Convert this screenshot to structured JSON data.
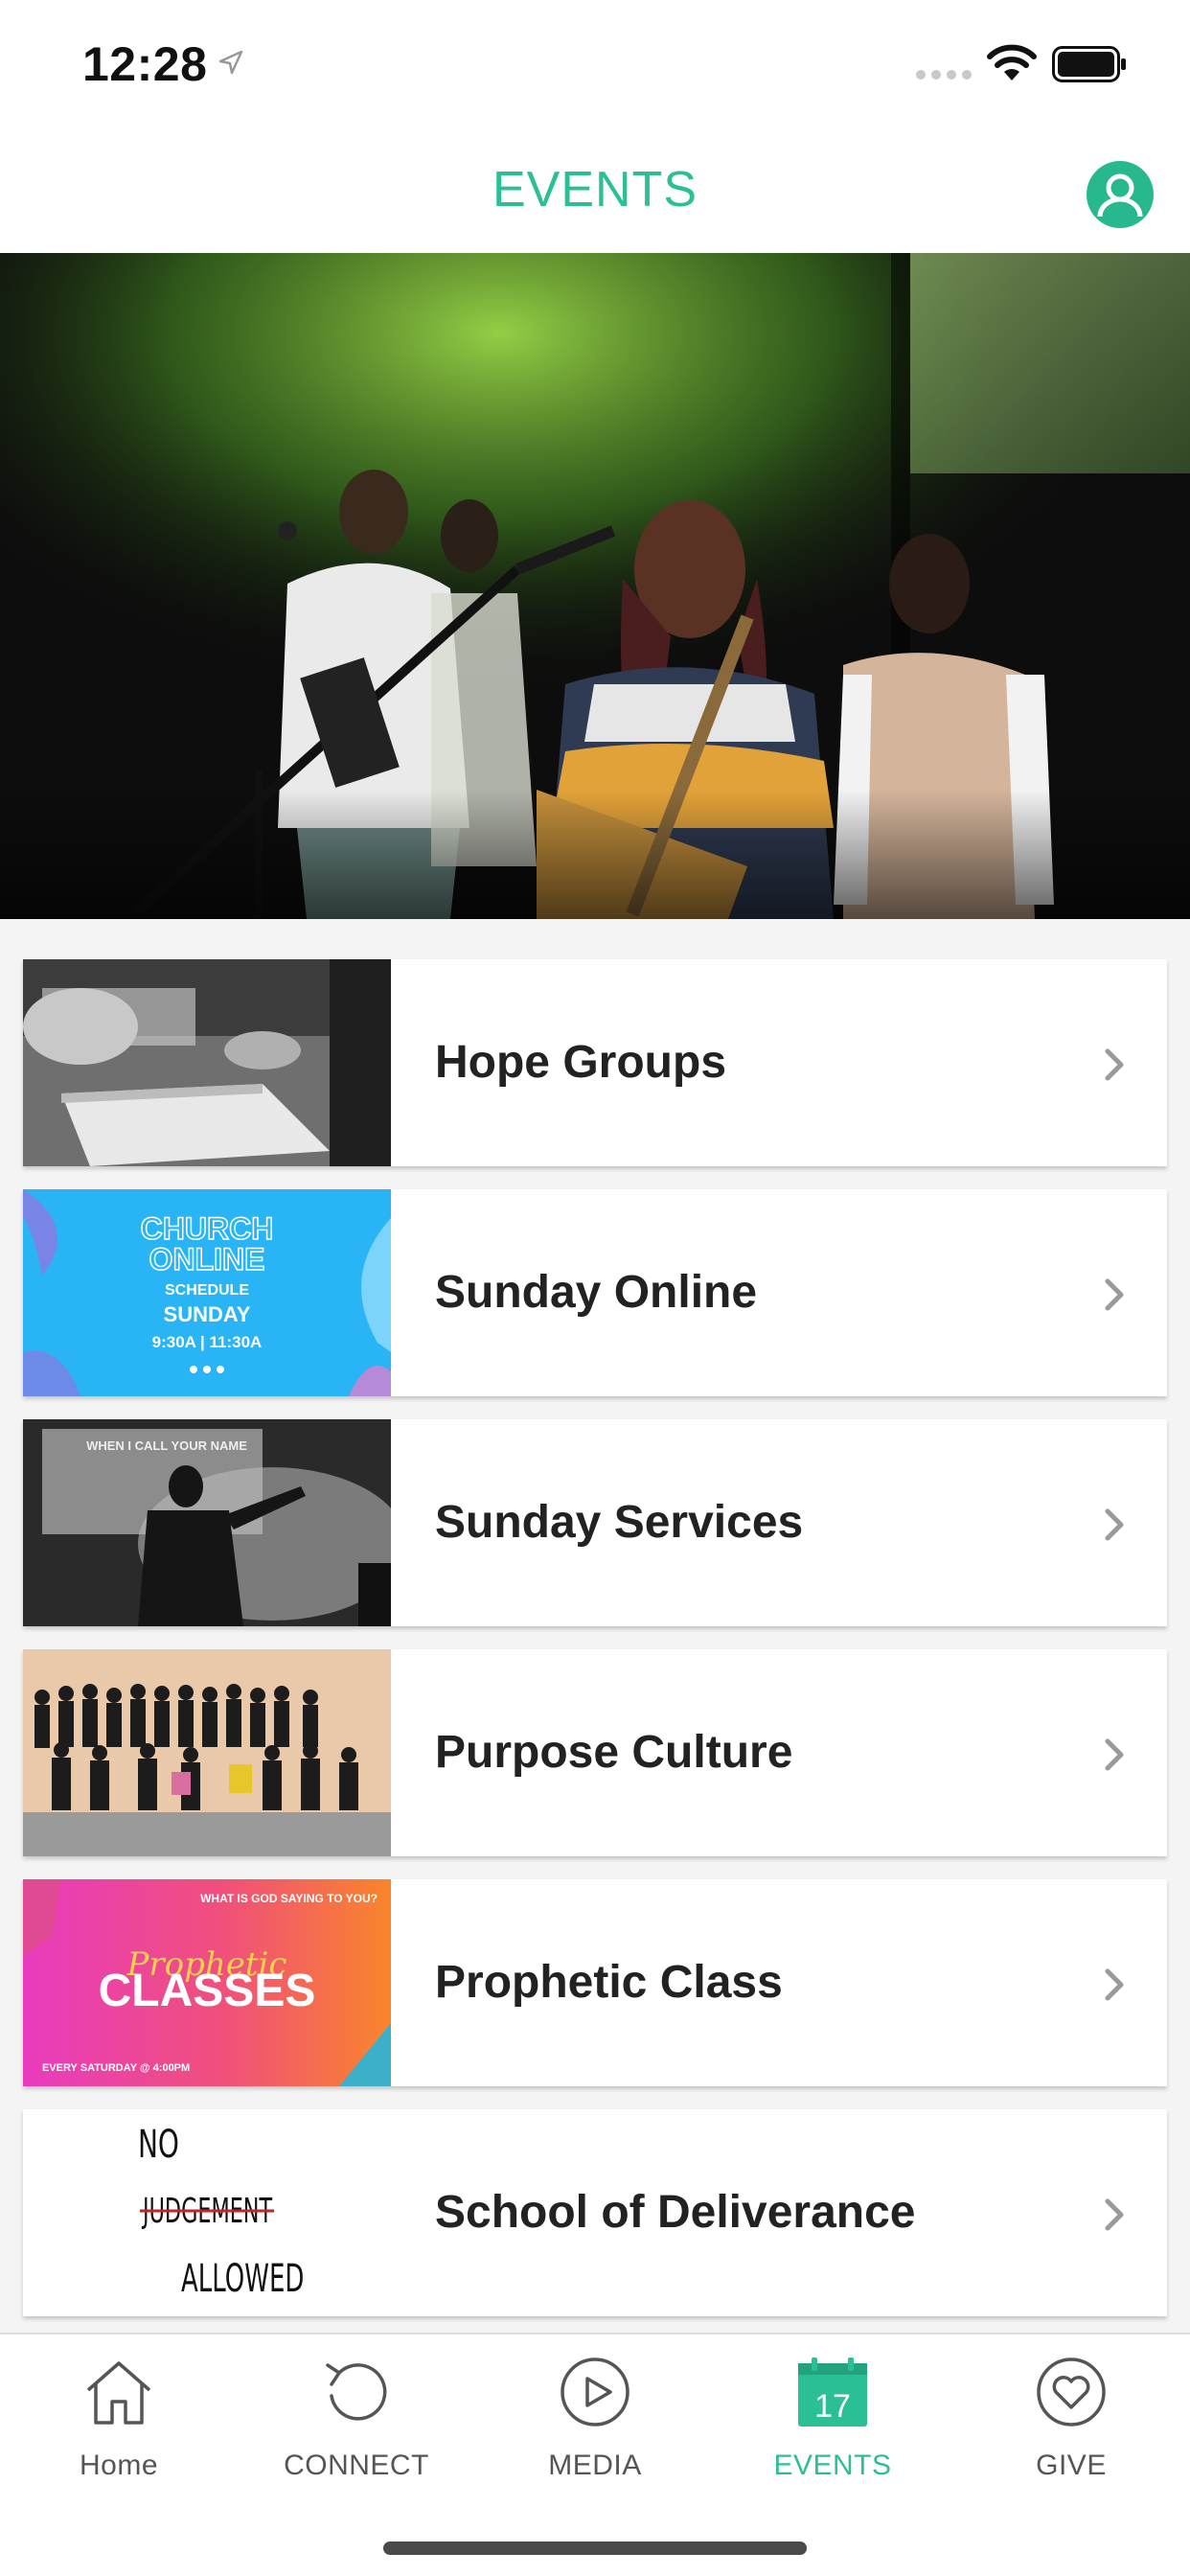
{
  "status_bar": {
    "time": "12:28"
  },
  "header": {
    "title": "EVENTS"
  },
  "events": [
    {
      "label": "Hope Groups"
    },
    {
      "label": "Sunday Online"
    },
    {
      "label": "Sunday Services"
    },
    {
      "label": "Purpose Culture"
    },
    {
      "label": "Prophetic Class"
    },
    {
      "label": "School of Deliverance"
    }
  ],
  "thumb_text": {
    "sunday_online": {
      "line1": "CHURCH",
      "line2": "ONLINE",
      "line3": "SCHEDULE",
      "line4": "SUNDAY",
      "line5": "9:30A  |  11:30A"
    },
    "sunday_services": {
      "line1": "WHEN I CALL YOUR NAME"
    },
    "prophetic": {
      "top": "WHAT IS GOD SAYING TO YOU?",
      "script": "Prophetic",
      "main": "CLASSES",
      "bottom": "EVERY SATURDAY @ 4:00PM"
    },
    "deliverance": {
      "line1": "NO",
      "line2": "JUDGEMENT",
      "line3": "ALLOWED"
    }
  },
  "tabs": [
    {
      "label": "Home",
      "icon": "house-icon"
    },
    {
      "label": "CONNECT",
      "icon": "refresh-icon"
    },
    {
      "label": "MEDIA",
      "icon": "play-circle-icon"
    },
    {
      "label": "EVENTS",
      "icon": "calendar-icon",
      "badge": "17"
    },
    {
      "label": "GIVE",
      "icon": "heart-circle-icon"
    }
  ],
  "colors": {
    "accent": "#2bbf95",
    "text": "#222222",
    "background": "#f4f4f4"
  }
}
